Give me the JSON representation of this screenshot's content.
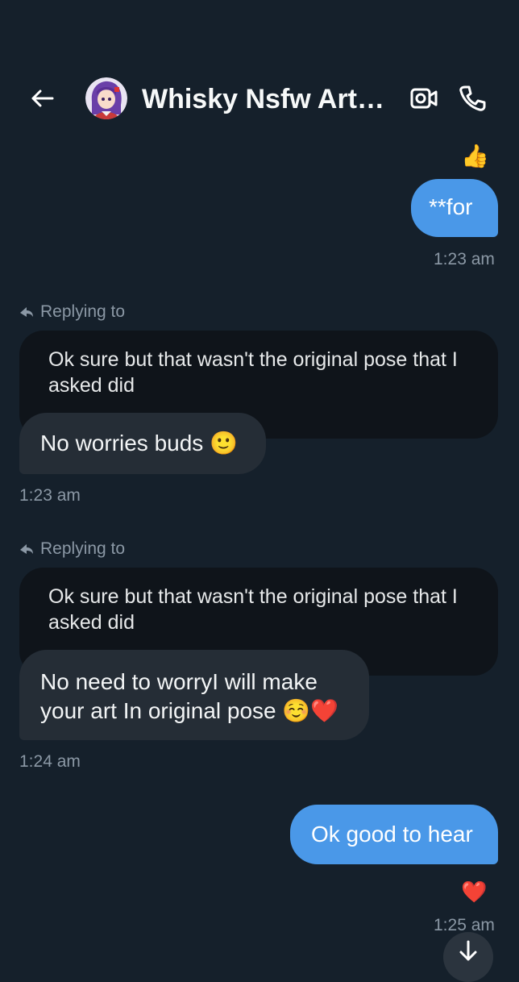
{
  "header": {
    "back_icon": "arrow-left-icon",
    "avatar_icon": "avatar-image",
    "title": "Whisky Nsfw Artist...",
    "video_icon": "video-camera-icon",
    "call_icon": "phone-icon"
  },
  "messages": [
    {
      "direction": "outgoing",
      "reaction": "👍",
      "text": "**for",
      "time": "1:23 am"
    },
    {
      "direction": "incoming",
      "reply_label": "Replying to",
      "quoted_text": "Ok sure but that wasn't the original pose that I asked did",
      "text": "No worries buds 🙂",
      "time": "1:23 am"
    },
    {
      "direction": "incoming",
      "reply_label": "Replying to",
      "quoted_text": "Ok sure but that wasn't the original pose that I asked did",
      "text": "No need to worryI will make your art In original pose ☺️❤️",
      "time": "1:24 am"
    },
    {
      "direction": "outgoing",
      "text": "Ok good to hear",
      "reaction": "❤️",
      "time": "1:25 am"
    }
  ],
  "colors": {
    "background": "#15202b",
    "outgoing_bubble": "#4a98e8",
    "incoming_bubble": "#252d36",
    "quoted_bubble": "#0f141a",
    "muted_text": "#8b98a5"
  },
  "scroll_down_icon": "arrow-down-icon"
}
